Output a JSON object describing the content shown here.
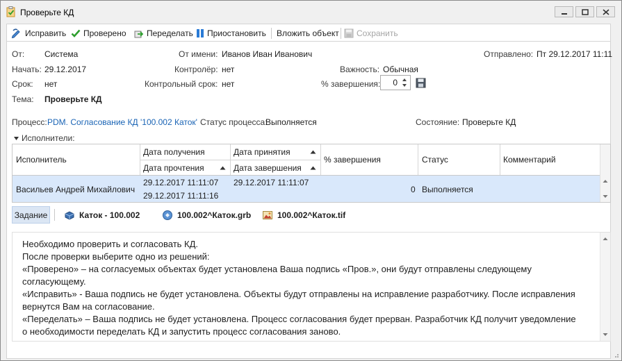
{
  "window": {
    "title": "Проверьте КД"
  },
  "toolbar": {
    "fix": "Исправить",
    "checked": "Проверено",
    "redo": "Переделать",
    "suspend": "Приостановить",
    "attach": "Вложить объект",
    "save": "Сохранить"
  },
  "fields": {
    "from_label": "От:",
    "from_value": "Система",
    "on_behalf_label": "От имени:",
    "on_behalf_value": "Иванов Иван Иванович",
    "sent_label": "Отправлено:",
    "sent_value": "Пт 29.12.2017 11:11",
    "start_label": "Начать:",
    "start_value": "29.12.2017",
    "controller_label": "Контролёр:",
    "controller_value": "нет",
    "importance_label": "Важность:",
    "importance_value": "Обычная",
    "due_label": "Срок:",
    "due_value": "нет",
    "control_due_label": "Контрольный срок:",
    "control_due_value": "нет",
    "completion_label": "% завершения:",
    "completion_value": "0",
    "subject_label": "Тема:",
    "subject_value": "Проверьте КД"
  },
  "process": {
    "label": "Процесс:",
    "value": "PDM. Согласование КД '100.002 Каток'",
    "status_label": "Статус процесса:",
    "status_value": "Выполняется",
    "state_label": "Состояние:",
    "state_value": "Проверьте КД"
  },
  "executors": {
    "section_label": "Исполнители:",
    "headers": {
      "executor": "Исполнитель",
      "received": "Дата получения",
      "read": "Дата прочтения",
      "accepted": "Дата принятия",
      "finished": "Дата завершения",
      "completion": "% завершения",
      "status": "Статус",
      "comment": "Комментарий"
    },
    "rows": [
      {
        "executor": "Васильев Андрей Михайлович",
        "received": "29.12.2017 11:11:07",
        "read": "29.12.2017 11:11:16",
        "accepted": "29.12.2017 11:11:07",
        "finished": "",
        "completion": "0",
        "status": "Выполняется",
        "comment": ""
      }
    ]
  },
  "tabs": {
    "task": "Задание",
    "obj1": "Каток - 100.002",
    "obj2": "100.002^Каток.grb",
    "obj3": "100.002^Каток.tif"
  },
  "description": {
    "lines": [
      "Необходимо проверить и согласовать КД.",
      "После проверки выберите одно из решений:",
      "«Проверено» – на согласуемых объектах будет установлена Ваша подпись «Пров.», они будут отправлены следующему",
      "согласующему.",
      "«Исправить» - Ваша подпись не будет установлена. Объекты будут отправлены на исправление разработчику. После исправления",
      "вернутся Вам на согласование.",
      "«Переделать» – Ваша подпись не будет установлена. Процесс согласования будет прерван. Разработчик КД получит уведомление",
      "о необходимости переделать КД и запустить процесс согласования заново."
    ]
  },
  "colors": {
    "link": "#1a64b5",
    "row_selected": "#d9e8fb",
    "check_green": "#2e9e2e",
    "pause_blue": "#2a7bd6"
  }
}
